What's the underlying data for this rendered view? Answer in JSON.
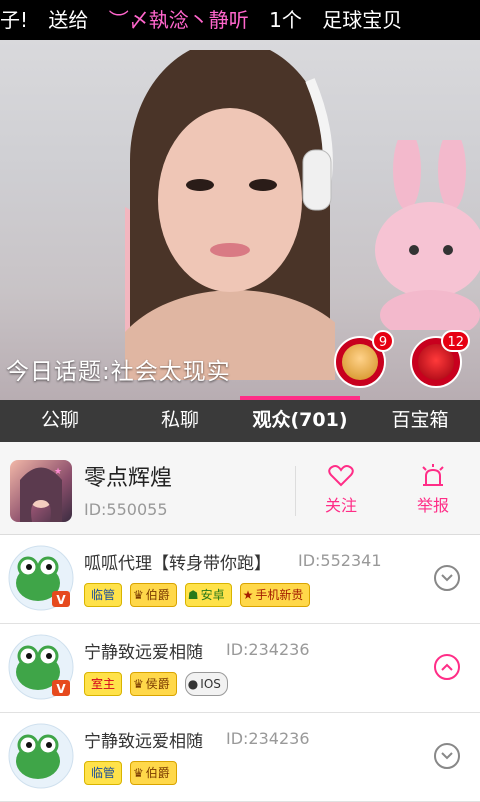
{
  "marquee": {
    "parts": [
      {
        "text": "子!",
        "color": "white"
      },
      {
        "text": "送给",
        "color": "white"
      },
      {
        "text": "︶〆執淰丶静听",
        "color": "pink"
      },
      {
        "text": "1个",
        "color": "white"
      },
      {
        "text": "足球宝贝",
        "color": "white"
      }
    ]
  },
  "video": {
    "topic": "今日话题:社会太现实",
    "gifts": [
      {
        "icon": "gift-avatar-icon",
        "count": "9"
      },
      {
        "icon": "rose-icon",
        "count": "12"
      }
    ]
  },
  "tabs": [
    {
      "label": "公聊",
      "active": false
    },
    {
      "label": "私聊",
      "active": false
    },
    {
      "label": "观众(701)",
      "active": true
    },
    {
      "label": "百宝箱",
      "active": false
    }
  ],
  "host": {
    "name": "零点辉煌",
    "id": "ID:550055",
    "follow_label": "关注",
    "report_label": "举报"
  },
  "audience": [
    {
      "name": "呱呱代理【转身带你跑】",
      "id": "ID:552341",
      "tags": [
        "临管",
        "伯爵",
        "安卓",
        "手机新贵"
      ],
      "expanded": false
    },
    {
      "name": "宁静致远爱相随",
      "id": "ID:234236",
      "tags": [
        "室主",
        "侯爵",
        "IOS"
      ],
      "expanded": true
    },
    {
      "name": "宁静致远爱相随",
      "id": "ID:234236",
      "tags": [
        "临管",
        "伯爵"
      ],
      "expanded": false
    }
  ],
  "colors": {
    "accent": "#ff2d87",
    "tab_bar": "#3a3a3a"
  }
}
